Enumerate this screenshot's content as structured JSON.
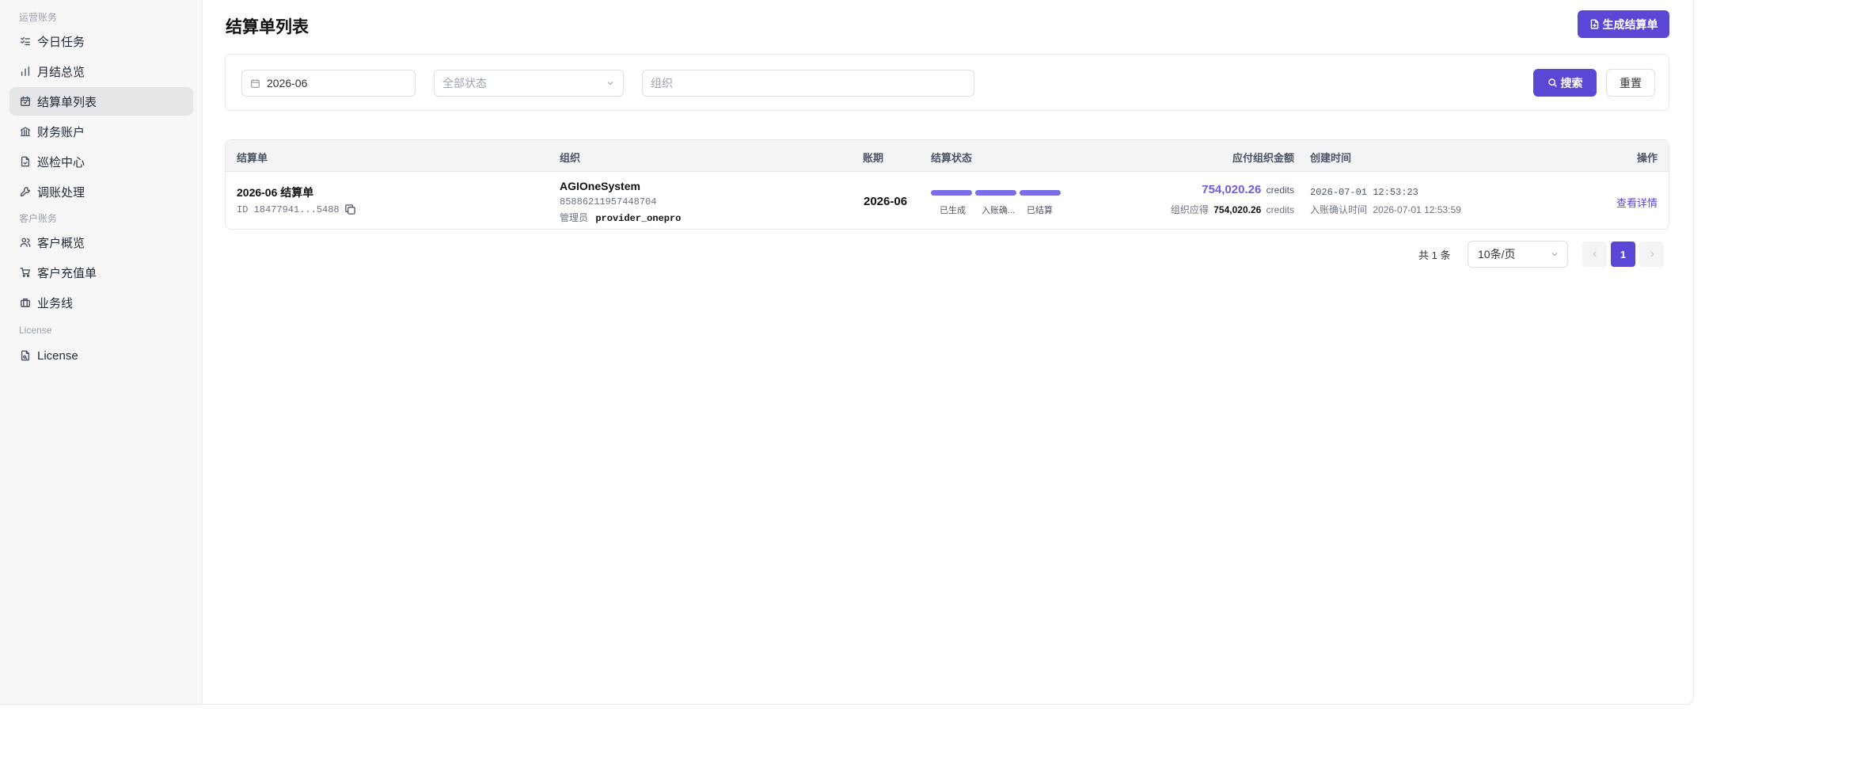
{
  "sidebar": {
    "groups": [
      {
        "label": "运营账务"
      },
      {
        "label": "客户账务"
      },
      {
        "label": "License"
      }
    ],
    "items": [
      {
        "label": "今日任务",
        "icon": "checklist-icon"
      },
      {
        "label": "月结总览",
        "icon": "bar-chart-icon"
      },
      {
        "label": "结算单列表",
        "icon": "calendar-icon",
        "active": true
      },
      {
        "label": "财务账户",
        "icon": "bank-icon"
      },
      {
        "label": "巡检中心",
        "icon": "file-check-icon"
      },
      {
        "label": "调账处理",
        "icon": "wrench-icon"
      },
      {
        "label": "客户概览",
        "icon": "users-icon"
      },
      {
        "label": "客户充值单",
        "icon": "cart-icon"
      },
      {
        "label": "业务线",
        "icon": "briefcase-icon"
      },
      {
        "label": "License",
        "icon": "license-icon"
      }
    ]
  },
  "header": {
    "title": "结算单列表",
    "generate_button": "生成结算单"
  },
  "filters": {
    "month_value": "2026-06",
    "status_placeholder": "全部状态",
    "org_placeholder": "组织",
    "search_button": "搜索",
    "reset_button": "重置"
  },
  "table": {
    "columns": [
      "结算单",
      "组织",
      "账期",
      "结算状态",
      "应付组织金额",
      "创建时间",
      "操作"
    ],
    "rows": [
      {
        "title": "2026-06 结算单",
        "id_text": "ID 18477941...5488",
        "org_name": "AGIOneSystem",
        "org_id": "85886211957448704",
        "admin_label": "管理员",
        "admin_value": "provider_onepro",
        "period": "2026-06",
        "steps": [
          "已生成",
          "入账确...",
          "已结算"
        ],
        "steps_progress": 1.0,
        "amount": "754,020.26",
        "amount_unit": "credits",
        "org_due_label": "组织应得",
        "org_due_amount": "754,020.26",
        "org_due_unit": "credits",
        "created": "2026-07-01 12:53:23",
        "confirm_label": "入账确认时间",
        "confirm_time": "2026-07-01 12:53:59",
        "action": "查看详情"
      }
    ]
  },
  "pagination": {
    "total_text": "共 1 条",
    "page_size": "10条/页",
    "current_page": "1",
    "prev_icon": "chevron-left-icon",
    "next_icon": "chevron-right-icon"
  },
  "colors": {
    "accent": "#5b47d6",
    "progress": "#7c6ce8",
    "amount": "#6d5ce0"
  }
}
